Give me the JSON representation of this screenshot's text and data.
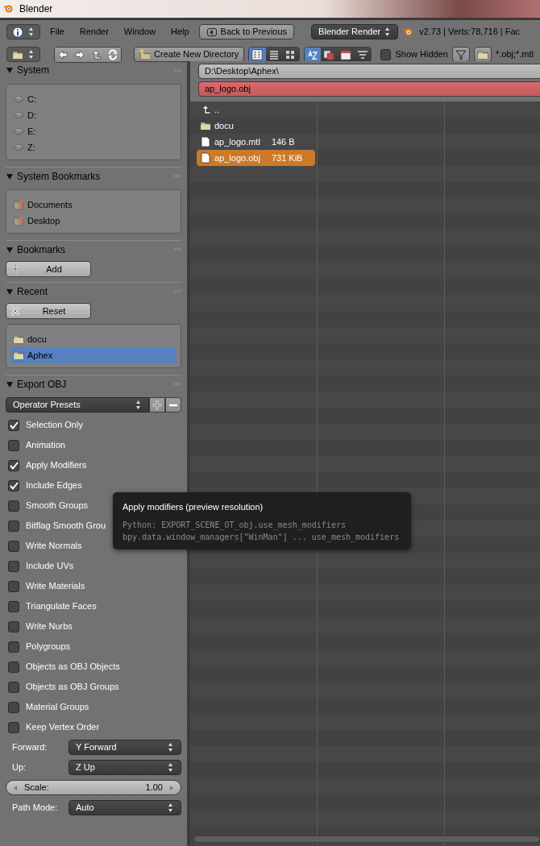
{
  "window": {
    "title": "Blender"
  },
  "header": {
    "menus": [
      "File",
      "Render",
      "Window",
      "Help"
    ],
    "back_button": "Back to Previous",
    "render_engine": "Blender Render",
    "stats": "v2.73 | Verts:78,716 | Fac"
  },
  "toolbar": {
    "create_button": "Create New Directory",
    "display_modes": [
      {
        "kind": "short",
        "selected": true
      },
      {
        "kind": "long",
        "selected": false
      },
      {
        "kind": "thumbnails",
        "selected": false
      }
    ],
    "sort_modes": [
      {
        "kind": "alpha",
        "selected": true
      },
      {
        "kind": "extension",
        "selected": false
      },
      {
        "kind": "time",
        "selected": false
      },
      {
        "kind": "size",
        "selected": false
      }
    ],
    "show_hidden": {
      "label": "Show Hidden",
      "checked": false
    },
    "filter_text": "*.obj;*.mtl"
  },
  "system": {
    "title": "System",
    "drives": [
      "C:",
      "D:",
      "E:",
      "Z:"
    ]
  },
  "system_bookmarks": {
    "title": "System Bookmarks",
    "items": [
      "Documents",
      "Desktop"
    ]
  },
  "bookmarks": {
    "title": "Bookmarks",
    "add_button": "Add"
  },
  "recent": {
    "title": "Recent",
    "reset_button": "Reset",
    "items": [
      {
        "label": "docu",
        "selected": false
      },
      {
        "label": "Aphex",
        "selected": true
      }
    ]
  },
  "export_obj": {
    "title": "Export OBJ",
    "presets": "Operator Presets",
    "options": [
      {
        "label": "Selection Only",
        "checked": true
      },
      {
        "label": "Animation",
        "checked": false
      },
      {
        "label": "Apply Modifiers",
        "checked": true
      },
      {
        "label": "Include Edges",
        "checked": true
      },
      {
        "label": "Smooth Groups",
        "checked": false
      },
      {
        "label": "Bitflag Smooth Grou",
        "checked": false
      },
      {
        "label": "Write Normals",
        "checked": false
      },
      {
        "label": "Include UVs",
        "checked": false
      },
      {
        "label": "Write Materials",
        "checked": false
      },
      {
        "label": "Triangulate Faces",
        "checked": false
      },
      {
        "label": "Write Nurbs",
        "checked": false
      },
      {
        "label": "Polygroups",
        "checked": false
      },
      {
        "label": "Objects as OBJ Objects",
        "checked": false
      },
      {
        "label": "Objects as OBJ Groups",
        "checked": false
      },
      {
        "label": "Material Groups",
        "checked": false
      },
      {
        "label": "Keep Vertex Order",
        "checked": false
      }
    ],
    "fields": [
      {
        "kind": "dropdown",
        "label": "Forward:",
        "value": "Y Forward"
      },
      {
        "kind": "dropdown",
        "label": "Up:",
        "value": "Z Up"
      },
      {
        "kind": "number",
        "label": "Scale:",
        "value": "1.00"
      },
      {
        "kind": "dropdown",
        "label": "Path Mode:",
        "value": "Auto"
      }
    ]
  },
  "path": "D:\\Desktop\\Aphex\\",
  "filename": "ap_logo.obj",
  "files": [
    {
      "kind": "parent",
      "name": "..",
      "selected": false
    },
    {
      "kind": "folder",
      "name": "docu",
      "selected": false
    },
    {
      "kind": "file",
      "name": "ap_logo.mtl",
      "size": "146 B",
      "selected": false
    },
    {
      "kind": "file",
      "name": "ap_logo.obj",
      "size": "731 KiB",
      "selected": true
    }
  ],
  "tooltip": {
    "title": "Apply modifiers (preview resolution)",
    "lines": [
      "Python: EXPORT_SCENE_OT_obj.use_mesh_modifiers",
      "bpy.data.window_managers[\"WinMan\"] ... use_mesh_modifiers"
    ]
  }
}
